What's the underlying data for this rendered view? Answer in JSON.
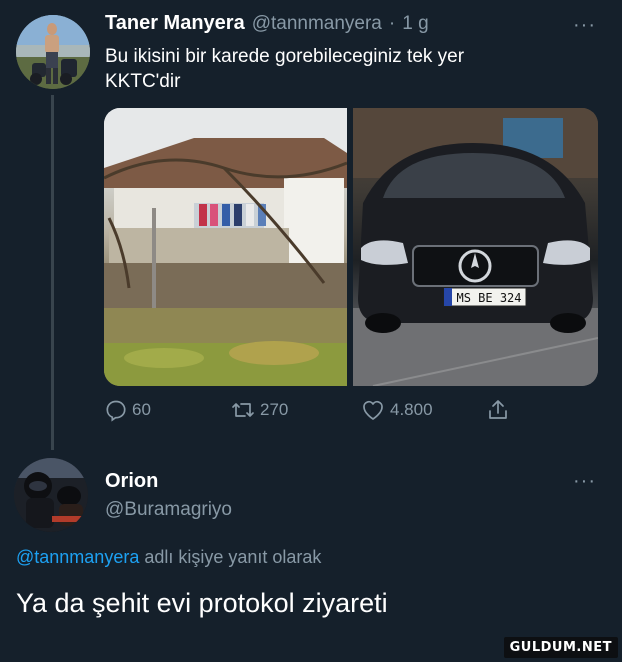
{
  "tweet": {
    "display_name": "Taner Manyera",
    "handle": "@tannmanyera",
    "separator": "·",
    "time": "1 g",
    "text_lines": [
      "Bu ikisini bir karede gorebileceginiz tek yer",
      "KKTC'dir"
    ],
    "media": [
      {
        "description": "Eski ev",
        "plate_text": ""
      },
      {
        "description": "Siyah Mercedes",
        "plate_text": "MS BE 324"
      }
    ],
    "reply_count": "60",
    "retweet_count": "270",
    "like_count": "4.800",
    "more": "···"
  },
  "reply": {
    "display_name": "Orion",
    "handle": "@Buramagriyo",
    "more": "···",
    "reply_to_mention": "@tannmanyera",
    "reply_to_suffix": " adlı kişiye yanıt olarak",
    "text": "Ya da şehit evi protokol ziyareti"
  },
  "watermark": "GULDUM.NET",
  "colors": {
    "background": "#15202b",
    "text_primary": "#ffffff",
    "text_secondary": "#8899a6",
    "link": "#1da1f2",
    "thread_line": "#38444d"
  }
}
